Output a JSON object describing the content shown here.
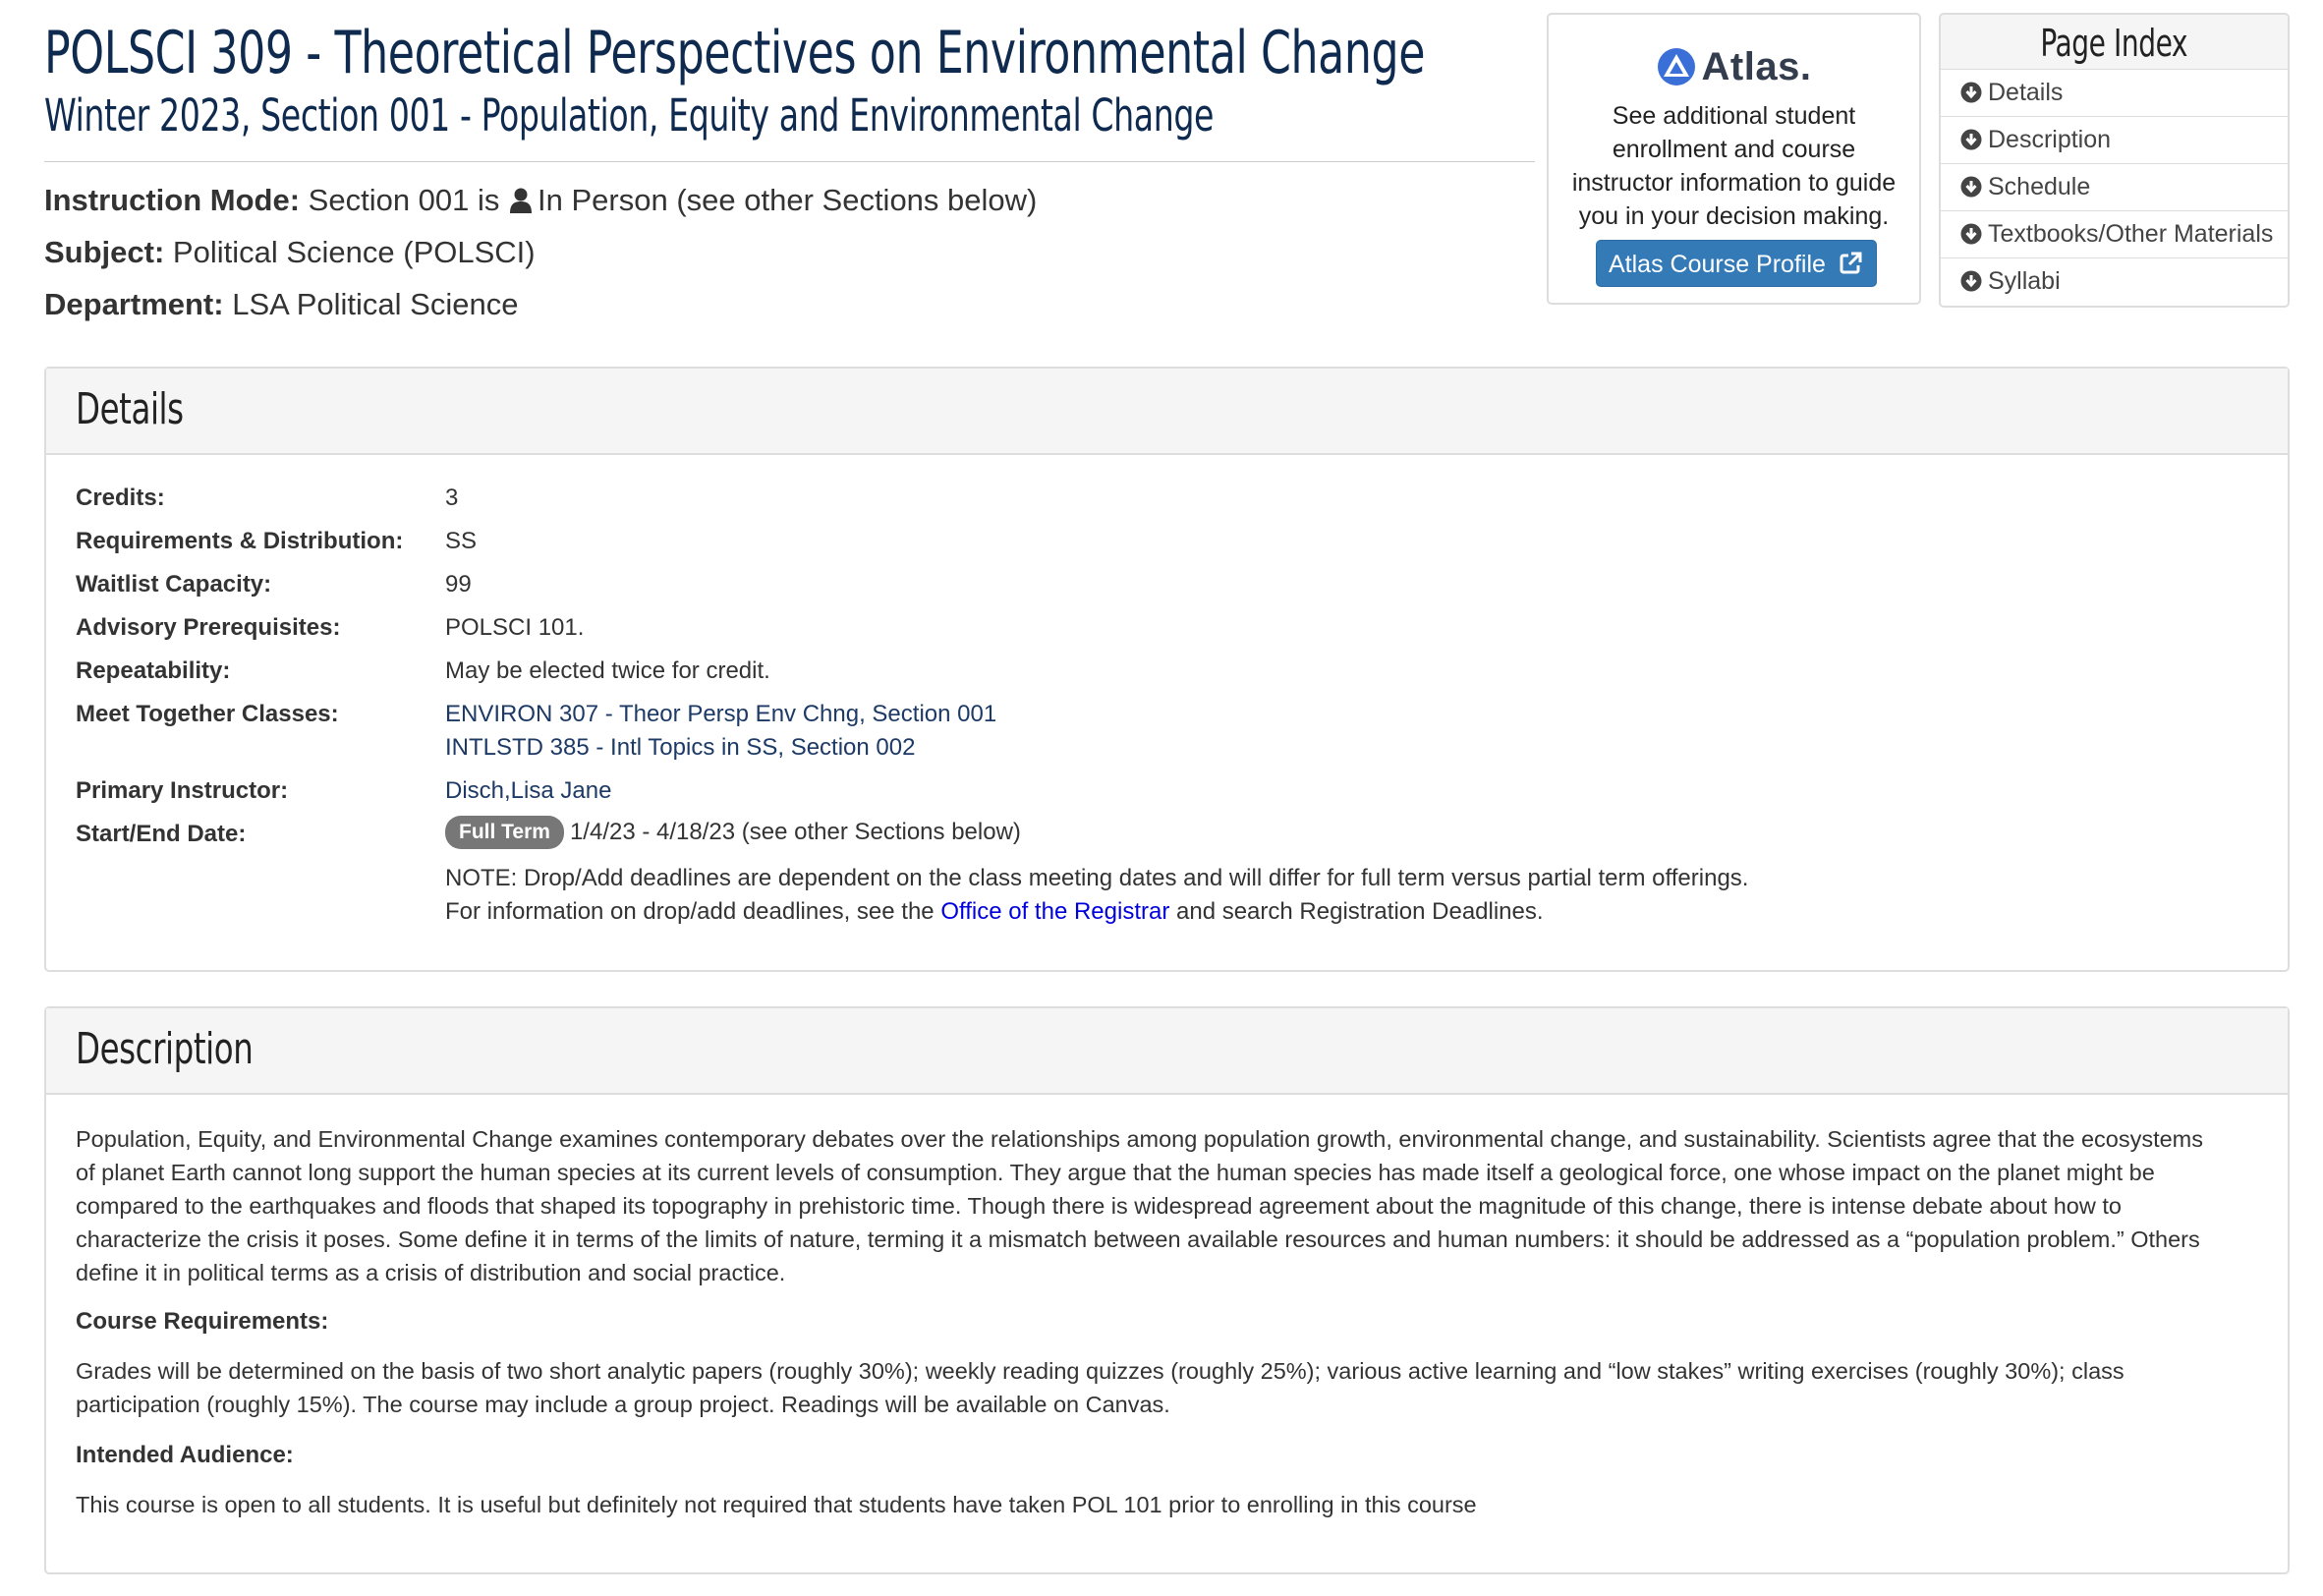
{
  "header": {
    "title": "POLSCI 309 - Theoretical Perspectives on Environmental Change",
    "subtitle": "Winter 2023, Section 001 - Population, Equity and Environmental Change"
  },
  "info": {
    "instruction_mode_label": "Instruction Mode:",
    "instruction_mode_pre": "Section 001 is",
    "instruction_mode_value": "In Person (see other Sections below)",
    "subject_label": "Subject:",
    "subject_value": "Political Science (POLSCI)",
    "department_label": "Department:",
    "department_value": "LSA Political Science"
  },
  "atlas": {
    "logo_text": "Atlas.",
    "description": "See additional student enrollment and course instructor information to guide you in your decision making.",
    "button_label": "Atlas Course Profile",
    "icon": "external-link-icon"
  },
  "page_index": {
    "title": "Page Index",
    "items": [
      "Details",
      "Description",
      "Schedule",
      "Textbooks/Other Materials",
      "Syllabi"
    ],
    "icon": "arrow-circle-down-icon"
  },
  "details": {
    "heading": "Details",
    "credits_label": "Credits:",
    "credits_value": "3",
    "requirements_label": "Requirements & Distribution:",
    "requirements_value": "SS",
    "waitlist_label": "Waitlist Capacity:",
    "waitlist_value": "99",
    "prereq_label": "Advisory Prerequisites:",
    "prereq_value": "POLSCI 101.",
    "repeat_label": "Repeatability:",
    "repeat_value": "May be elected twice for credit.",
    "meet_label": "Meet Together Classes:",
    "meet_classes": [
      "ENVIRON 307 - Theor Persp Env Chng, Section 001",
      "INTLSTD 385 - Intl Topics in SS, Section 002"
    ],
    "instructor_label": "Primary Instructor:",
    "instructor_value": "Disch,Lisa Jane",
    "dates_label": "Start/End Date:",
    "term_badge": "Full Term",
    "dates_value": "1/4/23 - 4/18/23 (see other Sections below)",
    "note_line1": "NOTE: Drop/Add deadlines are dependent on the class meeting dates and will differ for full term versus partial term offerings.",
    "note_line2_pre": "For information on drop/add deadlines, see the",
    "note_link": "Office of the Registrar",
    "note_line2_post": "and search Registration Deadlines."
  },
  "description": {
    "heading": "Description",
    "lines": [
      "Population, Equity, and Environmental Change examines contemporary debates over the relationships among population growth, environmental change, and sustainability. Scientists agree that the ecosystems",
      "of planet Earth cannot long support the human species at its current levels of consumption. They argue that the human species has made itself a geological force, one whose impact on the planet might be",
      "compared to the earthquakes and floods that shaped its topography in prehistoric time. Though there is widespread agreement about the magnitude of this change, there is intense debate about how to",
      "characterize the crisis it poses. Some define it in terms of the limits of nature, terming it a mismatch between available resources and human numbers: it should be addressed as a “population problem.” Others",
      "define it in political terms as a crisis of distribution and social practice."
    ],
    "requirements_heading": "Course Requirements:",
    "requirements_lines": [
      "Grades will be determined on the basis of two short analytic papers (roughly 30%); weekly reading quizzes (roughly 25%); various active learning and “low stakes” writing exercises (roughly 30%); class",
      "participation (roughly 15%). The course may include a group project. Readings will be available on Canvas."
    ],
    "audience_heading": "Intended Audience:",
    "audience_text": "This course is open to all students. It is useful but definitely not required that students have taken POL 101 prior to enrolling in this course"
  },
  "colors": {
    "title": "#0f2a4f",
    "link": "#1d3a66",
    "registrar_link": "#0000dd",
    "button": "#337ab7",
    "badge": "#777777"
  }
}
